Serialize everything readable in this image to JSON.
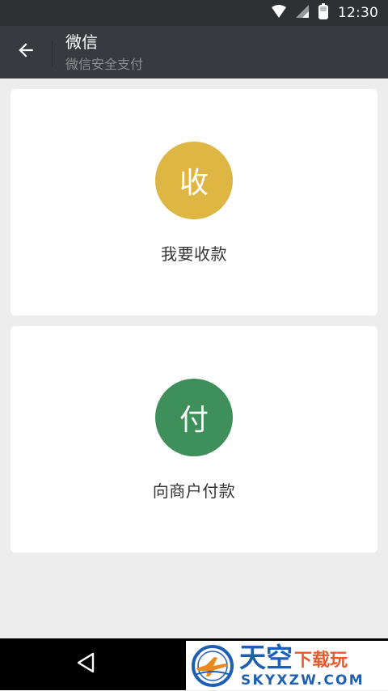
{
  "status_bar": {
    "time": "12:30",
    "icons": [
      "wifi-icon",
      "signal-icon",
      "battery-icon"
    ]
  },
  "title_bar": {
    "title": "微信",
    "subtitle": "微信安全支付",
    "back_icon": "arrow-left-icon"
  },
  "cards": {
    "collect": {
      "icon_text": "收",
      "label": "我要收款",
      "color": "#ddb643"
    },
    "pay": {
      "icon_text": "付",
      "label": "向商户付款",
      "color": "#3f8f5b"
    }
  },
  "nav_bar": {
    "back_icon": "triangle-back-icon"
  },
  "watermark": {
    "brand_main": "天空",
    "brand_sub": "下载玩",
    "url": "SKYXZW.COM"
  },
  "colors": {
    "status_bar_bg": "#2f3033",
    "title_bar_bg": "#393a3f",
    "page_bg": "#ededed"
  }
}
